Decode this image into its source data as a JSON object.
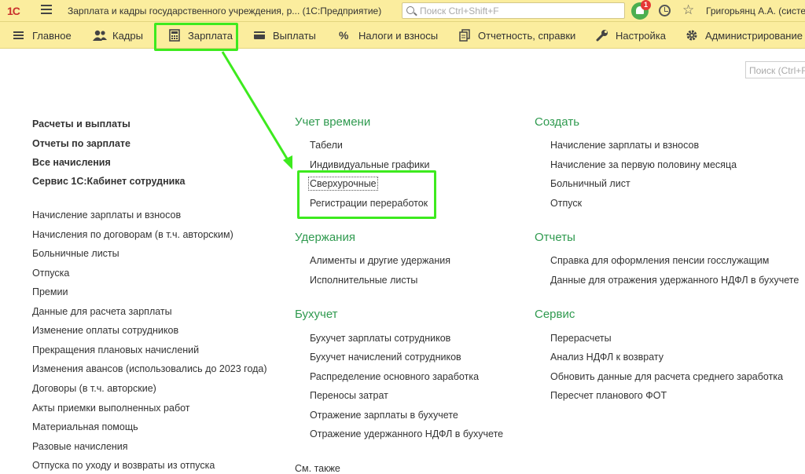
{
  "titlebar": {
    "logo": "1С",
    "app_title": "Зарплата и кадры государственного учреждения, р...  (1С:Предприятие)",
    "search_placeholder": "Поиск Ctrl+Shift+F",
    "notification_count": "1",
    "user": "Григорьянц А.А. (системн"
  },
  "menu": {
    "items": [
      {
        "label": "Главное",
        "icon": "hamburger-icon"
      },
      {
        "label": "Кадры",
        "icon": "people-icon"
      },
      {
        "label": "Зарплата",
        "icon": "calculator-icon"
      },
      {
        "label": "Выплаты",
        "icon": "wallet-icon"
      },
      {
        "label": "Налоги и взносы",
        "icon": "percent-icon"
      },
      {
        "label": "Отчетность, справки",
        "icon": "documents-icon"
      },
      {
        "label": "Настройка",
        "icon": "wrench-icon"
      },
      {
        "label": "Администрирование",
        "icon": "gear-icon"
      }
    ]
  },
  "content": {
    "search_placeholder": "Поиск (Ctrl+F)",
    "left_bold": [
      "Расчеты и выплаты",
      "Отчеты по зарплате",
      "Все начисления",
      "Сервис 1С:Кабинет сотрудника"
    ],
    "left_items": [
      "Начисление зарплаты и взносов",
      "Начисления по договорам (в т.ч. авторским)",
      "Больничные листы",
      "Отпуска",
      "Премии",
      "Данные для расчета зарплаты",
      "Изменение оплаты сотрудников",
      "Прекращения плановых начислений",
      "Изменения авансов (использовались до 2023 года)",
      "Договоры (в т.ч. авторские)",
      "Акты приемки выполненных работ",
      "Материальная помощь",
      "Разовые начисления",
      "Отпуска по уходу и возвраты из отпуска"
    ],
    "mid": {
      "time": {
        "title": "Учет времени",
        "items": [
          "Табели",
          "Индивидуальные графики",
          "Сверхурочные",
          "Регистрации переработок"
        ]
      },
      "deductions": {
        "title": "Удержания",
        "items": [
          "Алименты и другие удержания",
          "Исполнительные листы"
        ]
      },
      "accounting": {
        "title": "Бухучет",
        "items": [
          "Бухучет зарплаты сотрудников",
          "Бухучет начислений сотрудников",
          "Распределение основного заработка",
          "Переносы затрат",
          "Отражение зарплаты в бухучете",
          "Отражение удержанного НДФЛ в бухучете"
        ]
      },
      "see_also": "См. также"
    },
    "right": {
      "create": {
        "title": "Создать",
        "items": [
          "Начисление зарплаты и взносов",
          "Начисление за первую половину месяца",
          "Больничный лист",
          "Отпуск"
        ]
      },
      "reports": {
        "title": "Отчеты",
        "items": [
          "Справка для оформления пенсии госслужащим",
          "Данные для отражения удержанного НДФЛ в бухучете"
        ]
      },
      "service": {
        "title": "Сервис",
        "items": [
          "Перерасчеты",
          "Анализ НДФЛ к возврату",
          "Обновить данные для расчета среднего заработка",
          "Пересчет планового ФОТ"
        ]
      }
    }
  },
  "colors": {
    "accent_green": "#2f9a4f",
    "highlight": "#3dea1e",
    "toolbar": "#fbed9e"
  }
}
